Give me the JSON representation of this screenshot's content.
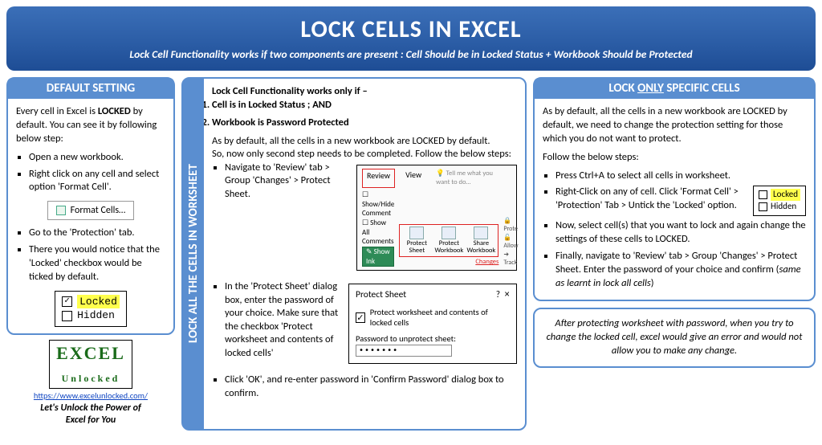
{
  "header": {
    "title": "LOCK CELLS IN EXCEL",
    "subtitle": "Lock Cell Functionality works if two components are present : Cell Should be in Locked Status + Workbook Should be Protected"
  },
  "left": {
    "title": "DEFAULT SETTING",
    "intro_a": "Every cell in Excel is ",
    "intro_b": "LOCKED",
    "intro_c": " by default. You can see it by following below step:",
    "steps": {
      "s1": "Open a new workbook.",
      "s2": "Right click on any cell and select option 'Format Cell'.",
      "s3": "Go to the 'Protection' tab.",
      "s4": "There you would notice that the 'Locked' checkbox would be ticked by default."
    },
    "menu_label": "Format Cells…",
    "chk_locked": "Locked",
    "chk_hidden": "Hidden"
  },
  "logo": {
    "brand": "EXCEL",
    "brand2": "Unlocked",
    "url": "https://www.excelunlocked.com/",
    "tag1": "Let's Unlock the Power of",
    "tag2": "Excel for You"
  },
  "mid": {
    "vtitle": "LOCK ALL THE CELLS IN WORKSHEET",
    "heading": "Lock Cell Functionality works only if –",
    "cond1": "Cell is in Locked Status ; AND",
    "cond2": "Workbook is Password Protected",
    "p1": "As by default, all the cells in a new workbook are LOCKED by default.",
    "p2": "So, now only second step needs to be completed. Follow the below steps:",
    "li1": "Navigate to 'Review' tab > Group 'Changes' > Protect Sheet.",
    "li2": "In the 'Protect Sheet' dialog box, enter the password of your choice. Make sure that the checkbox 'Protect worksheet and contents of locked cells'",
    "li3": "Click 'OK', and re-enter password  in 'Confirm Password' dialog box to confirm.",
    "ribbon": {
      "tab_review": "Review",
      "tab_view": "View",
      "tell_me": "Tell me what you want to do…",
      "opt1": "Show/Hide Comment",
      "opt2": "Show All Comments",
      "opt3": "Show Ink",
      "btn1a": "Protect",
      "btn1b": "Sheet",
      "btn2a": "Protect",
      "btn2b": "Workbook",
      "btn3a": "Share",
      "btn3b": "Workbook",
      "side1": "Prote",
      "side2": "Allow",
      "side3": "Track",
      "group": "Changes"
    },
    "dialog": {
      "title": "Protect Sheet",
      "q": "?",
      "x": "×",
      "chk": "Protect worksheet and contents of locked cells",
      "pw_label": "Password to unprotect sheet:",
      "pw_value": "•••••••"
    }
  },
  "right": {
    "title_a": "LOCK ",
    "title_b": "ONLY",
    "title_c": " SPECIFIC CELLS",
    "p1": "As by default, all the cells in a new workbook are LOCKED by default, we need to change the protection setting for those which you do not want to protect.",
    "p2": "Follow the below steps:",
    "li1": "Press Ctrl+A to select all cells in worksheet.",
    "li2": "Right-Click on any of cell. Click 'Format Cell' > 'Protection' Tab > Untick the 'Locked' option.",
    "li3": "Now, select cell(s) that you want to lock and again change the settings of these cells to LOCKED.",
    "li4_a": "Finally, navigate to 'Review' tab > Group 'Changes' > Protect Sheet. Enter the password of your choice and confirm (",
    "li4_b": "same as learnt in lock all cells",
    "li4_c": ")",
    "fig_locked": "Locked",
    "fig_hidden": "Hidden"
  },
  "note": "After protecting worksheet with password, when you try to change the locked cell, excel would give an error and would not allow you to make any change."
}
